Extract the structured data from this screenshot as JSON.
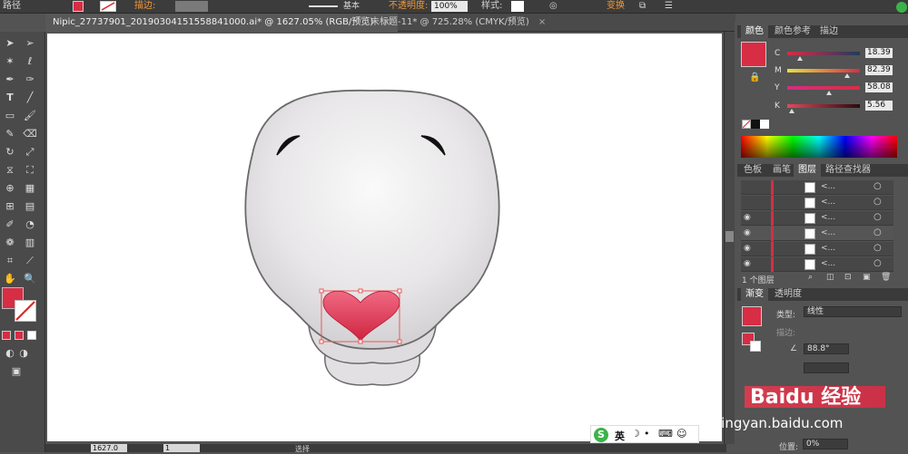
{
  "control_bar": {
    "mode_label": "路径",
    "stroke_label": "描边:",
    "stroke_style": "基本",
    "opacity_label": "不透明度:",
    "opacity_value": "100%",
    "style_label": "样式:",
    "transform_label": "变换"
  },
  "tabs": [
    {
      "label": "Nipic_27737901_20190304151558841000.ai* @ 1627.05% (RGB/预览)",
      "close": "×",
      "active": true
    },
    {
      "label": "未标题-11* @ 725.28% (CMYK/预览)",
      "close": "×",
      "active": false
    }
  ],
  "status_bar": {
    "zoom_value": "1627.0",
    "page_value": "1",
    "tool_status": "选择"
  },
  "color_panel": {
    "tabs": [
      "颜色",
      "颜色参考",
      "描边"
    ],
    "fill_color": "#d72d45",
    "channels": [
      {
        "label": "C",
        "value": "18.39",
        "fraction": 0.18
      },
      {
        "label": "M",
        "value": "82.39",
        "fraction": 0.82
      },
      {
        "label": "Y",
        "value": "58.08",
        "fraction": 0.58
      },
      {
        "label": "K",
        "value": "5.56",
        "fraction": 0.06
      }
    ]
  },
  "layers_panel": {
    "tabs": [
      "色板",
      "画笔",
      "图层",
      "路径查找器"
    ],
    "rows": [
      {
        "name": "<...",
        "visible": false
      },
      {
        "name": "<...",
        "visible": false
      },
      {
        "name": "<...",
        "visible": true
      },
      {
        "name": "<...",
        "visible": true
      },
      {
        "name": "<...",
        "visible": true
      },
      {
        "name": "<...",
        "visible": true
      }
    ],
    "footer_label": "1 个图层"
  },
  "gradient_panel": {
    "tabs": [
      "渐变",
      "透明度"
    ],
    "type_label": "类型:",
    "type_value": "线性",
    "stroke_label": "描边:",
    "angle_value": "88.8°",
    "position_label": "位置:",
    "position_value": "0%"
  },
  "ime_bar": {
    "lang": "英"
  },
  "watermark": {
    "brand": "Baidu 经验",
    "url": "jingyan.baidu.com"
  },
  "icons": [
    "selection-tool",
    "direct-selection-tool",
    "magic-wand",
    "lasso",
    "pen",
    "curvature",
    "type",
    "line",
    "rectangle",
    "paintbrush",
    "pencil",
    "eraser",
    "rotate",
    "scale",
    "width",
    "free-transform",
    "shape-builder",
    "perspective",
    "mesh",
    "gradient",
    "eyedropper",
    "blend",
    "symbol-sprayer",
    "column-graph",
    "artboard",
    "slice",
    "hand",
    "zoom"
  ]
}
